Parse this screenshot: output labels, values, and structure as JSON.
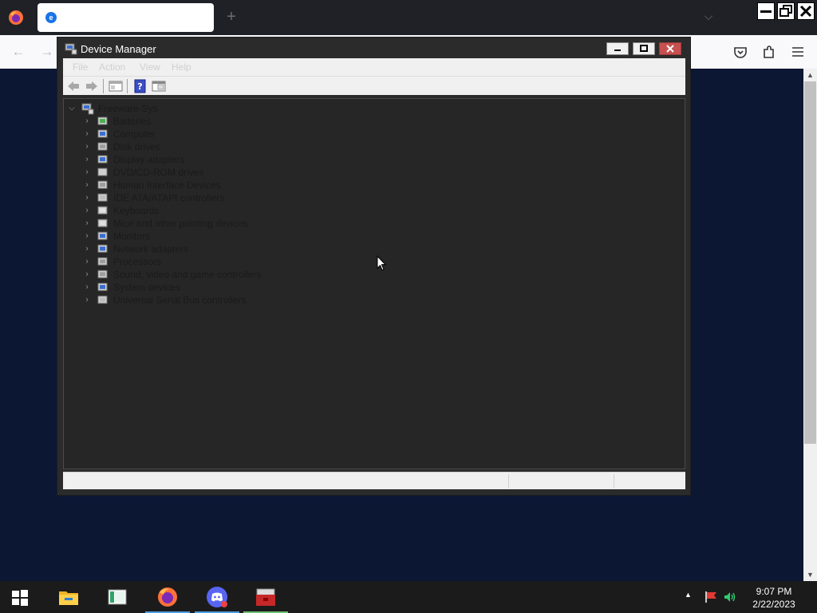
{
  "browser": {
    "tab": {
      "title": ""
    },
    "new_tab_symbol": "+",
    "tab_list_symbol": "⌵",
    "nav": {
      "back_symbol": "←",
      "forward_symbol": "→"
    }
  },
  "device_manager": {
    "title": "Device Manager",
    "menu": [
      "File",
      "Action",
      "View",
      "Help"
    ],
    "tree": {
      "root": {
        "label": "Freeware-Sys",
        "expander": "⌵"
      },
      "categories": [
        {
          "label": "Batteries",
          "icon": "battery-icon"
        },
        {
          "label": "Computer",
          "icon": "computer-icon"
        },
        {
          "label": "Disk drives",
          "icon": "disk-drive-icon"
        },
        {
          "label": "Display adapters",
          "icon": "display-adapter-icon"
        },
        {
          "label": "DVD/CD-ROM drives",
          "icon": "dvd-drive-icon"
        },
        {
          "label": "Human Interface Devices",
          "icon": "hid-icon"
        },
        {
          "label": "IDE ATA/ATAPI controllers",
          "icon": "ide-controller-icon"
        },
        {
          "label": "Keyboards",
          "icon": "keyboard-icon"
        },
        {
          "label": "Mice and other pointing devices",
          "icon": "mouse-icon"
        },
        {
          "label": "Monitors",
          "icon": "monitor-icon"
        },
        {
          "label": "Network adapters",
          "icon": "network-adapter-icon"
        },
        {
          "label": "Processors",
          "icon": "processor-icon"
        },
        {
          "label": "Sound, video and game controllers",
          "icon": "sound-icon"
        },
        {
          "label": "System devices",
          "icon": "system-devices-icon"
        },
        {
          "label": "Universal Serial Bus controllers",
          "icon": "usb-icon"
        }
      ],
      "collapsed_symbol": "›"
    }
  },
  "taskbar": {
    "apps": [
      "file-explorer",
      "notepad-app",
      "firefox",
      "discord",
      "toolbox-app"
    ],
    "clock": {
      "time": "9:07 PM",
      "date": "2/22/2023"
    },
    "tray_up_symbol": "▲"
  },
  "colors": {
    "desktop_bg": "#0b1733",
    "window_bg": "#2b2b2b",
    "tree_bg": "#262626",
    "close_red": "#c75050",
    "taskbar_bg": "#1b1b1b"
  }
}
